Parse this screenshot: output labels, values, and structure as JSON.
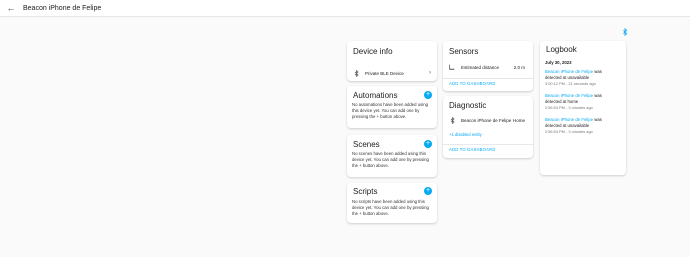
{
  "header": {
    "title": "Beacon iPhone de Felipe",
    "back_icon": "arrow-left-icon"
  },
  "colors": {
    "accent": "#03a9f4",
    "background": "#fafafa"
  },
  "device_info": {
    "title": "Device info",
    "row_label": "Private BLE Device",
    "icon": "bluetooth-icon"
  },
  "automations": {
    "title": "Automations",
    "text": "No automations have been added using this device yet. You can add one by pressing the + button above."
  },
  "scenes": {
    "title": "Scenes",
    "text": "No scenes have been added using this device yet. You can add one by pressing the + button above."
  },
  "scripts": {
    "title": "Scripts",
    "text": "No scripts have been added using this device yet. You can add one by pressing the + button above."
  },
  "sensors": {
    "title": "Sensors",
    "row_label": "Estimated distance",
    "row_value": "2.0 m",
    "add_link": "ADD TO DASHBOARD"
  },
  "diagnostic": {
    "title": "Diagnostic",
    "row_label": "Beacon iPhone de Felipe",
    "row_value": "Home",
    "disabled_link": "+1 disabled entity",
    "add_link": "ADD TO DASHBOARD"
  },
  "logbook": {
    "title": "Logbook",
    "date": "July 30, 2023",
    "entries": [
      {
        "entity": "Beacon iPhone de Felipe",
        "message": " was detected at unavailable",
        "time": "3:00:12 PM - 21 seconds ago"
      },
      {
        "entity": "Beacon iPhone de Felipe",
        "message": " was detected at home",
        "time": "2:56:53 PM - 3 minutes ago"
      },
      {
        "entity": "Beacon iPhone de Felipe",
        "message": " was detected at unavailable",
        "time": "2:56:53 PM - 3 minutes ago"
      }
    ]
  }
}
